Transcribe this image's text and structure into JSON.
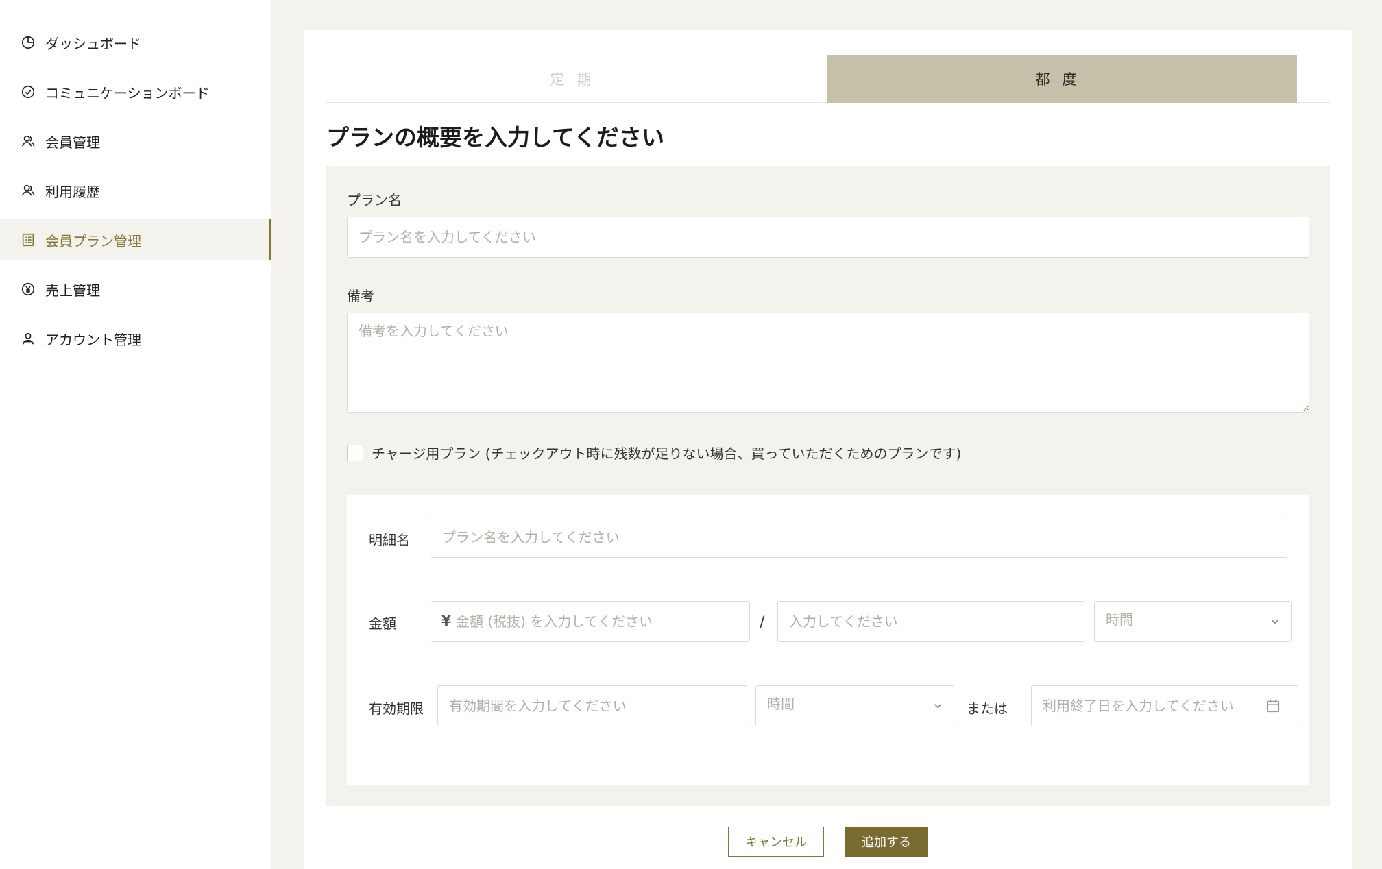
{
  "sidebar": {
    "items": [
      {
        "label": "ダッシュボード",
        "icon": "pie-chart-icon"
      },
      {
        "label": "コミュニケーションボード",
        "icon": "check-circle-icon"
      },
      {
        "label": "会員管理",
        "icon": "users-icon"
      },
      {
        "label": "利用履歴",
        "icon": "users-icon"
      },
      {
        "label": "会員プラン管理",
        "icon": "list-icon",
        "active": true
      },
      {
        "label": "売上管理",
        "icon": "yen-circle-icon"
      },
      {
        "label": "アカウント管理",
        "icon": "account-icon"
      }
    ]
  },
  "tabs": [
    {
      "label": "定期"
    },
    {
      "label": "都度",
      "active": true
    }
  ],
  "form": {
    "title": "プランの概要を入力してください",
    "plan_name": {
      "label": "プラン名",
      "placeholder": "プラン名を入力してください"
    },
    "note": {
      "label": "備考",
      "placeholder": "備考を入力してください"
    },
    "charge_plan_label": "チャージ用プラン (チェックアウト時に残数が足りない場合、買っていただくためのプランです)",
    "detail": {
      "item_name": {
        "label": "明細名",
        "placeholder": "プラン名を入力してください"
      },
      "price": {
        "label": "金額",
        "currency": "¥",
        "placeholder": "金額 (税抜) を入力してください",
        "separator": "/",
        "unit_placeholder": "入力してください",
        "unit_select": "時間"
      },
      "validity": {
        "label": "有効期限",
        "placeholder": "有効期間を入力してください",
        "unit_select": "時間",
        "or_label": "または",
        "end_date_placeholder": "利用終了日を入力してください"
      }
    },
    "buttons": {
      "cancel": "キャンセル",
      "add": "追加する"
    }
  },
  "colors": {
    "accent": "#857637",
    "tab_active": "#c6c0a8",
    "panel": "#f3f2ed"
  }
}
